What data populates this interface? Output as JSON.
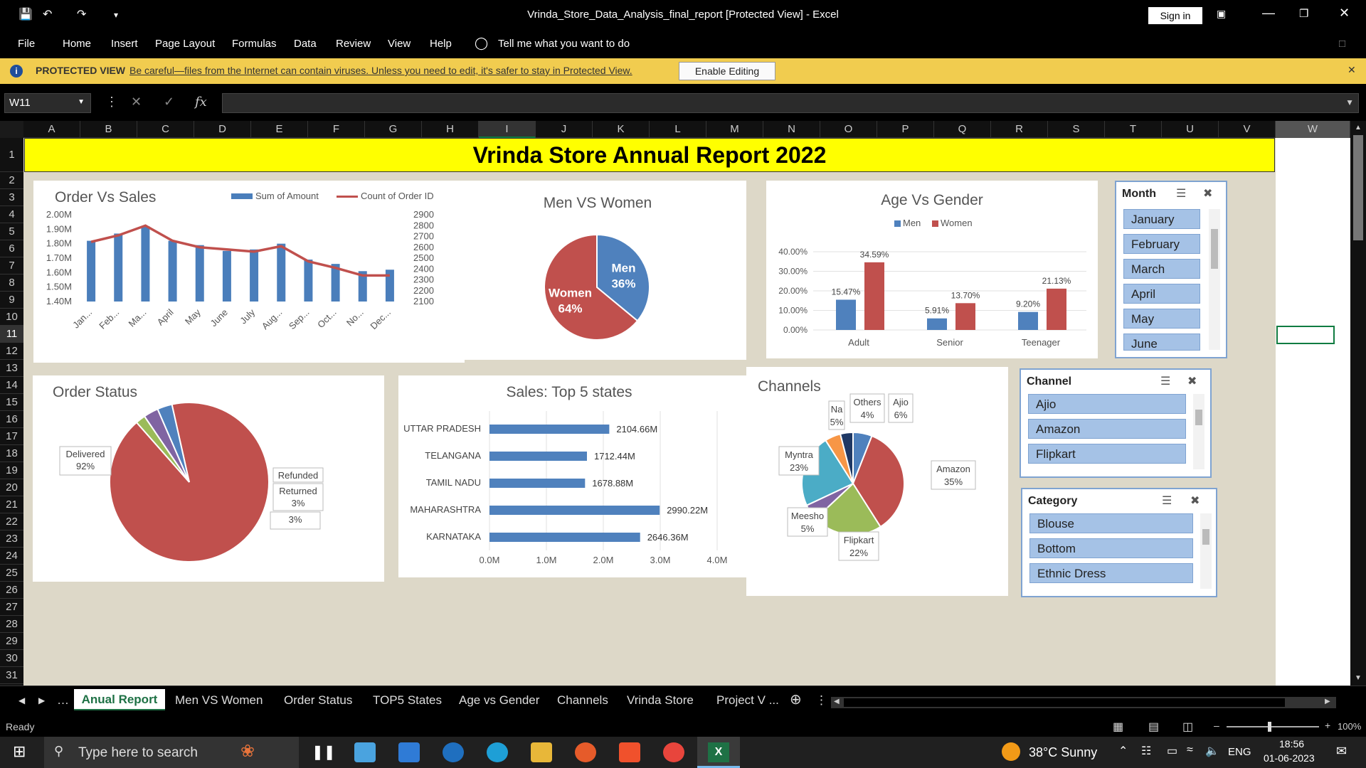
{
  "titlebar": {
    "title": "Vrinda_Store_Data_Analysis_final_report  [Protected View]  -  Excel",
    "signin": "Sign in"
  },
  "ribbon": {
    "tabs": [
      "File",
      "Home",
      "Insert",
      "Page Layout",
      "Formulas",
      "Data",
      "Review",
      "View",
      "Help"
    ],
    "tell_me": "Tell me what you want to do"
  },
  "protected": {
    "label": "PROTECTED VIEW",
    "message": "Be careful—files from the Internet can contain viruses. Unless you need to edit, it's safer to stay in Protected View.",
    "button": "Enable Editing"
  },
  "formula": {
    "name_box": "W11",
    "fx": "fx",
    "value": ""
  },
  "columns": [
    "A",
    "B",
    "C",
    "D",
    "E",
    "F",
    "G",
    "H",
    "I",
    "J",
    "K",
    "L",
    "M",
    "N",
    "O",
    "P",
    "Q",
    "R",
    "S",
    "T",
    "U",
    "V",
    "W"
  ],
  "rows": [
    "1",
    "2",
    "3",
    "4",
    "5",
    "6",
    "7",
    "8",
    "9",
    "10",
    "11",
    "12",
    "13",
    "14",
    "15",
    "16",
    "17",
    "18",
    "19",
    "20",
    "21",
    "22",
    "23",
    "24",
    "25",
    "26",
    "27",
    "28",
    "29",
    "30",
    "31"
  ],
  "report_title": "Vrinda Store Annual Report 2022",
  "charts": {
    "order_vs_sales": {
      "title": "Order Vs Sales",
      "legend": [
        "Sum of Amount",
        "Count of Order ID"
      ],
      "colors": [
        "#4a7ebb",
        "#c0504d"
      ]
    },
    "men_vs_women": {
      "title": "Men VS Women"
    },
    "age_vs_gender": {
      "title": "Age Vs Gender",
      "legend": [
        "Men",
        "Women"
      ]
    },
    "order_status": {
      "title": "Order Status"
    },
    "top5_states": {
      "title": "Sales: Top 5 states"
    },
    "channels": {
      "title": "Channels"
    }
  },
  "chart_data": [
    {
      "type": "bar+line",
      "title": "Order Vs Sales",
      "categories": [
        "Jan...",
        "Feb...",
        "Ma...",
        "April",
        "May",
        "June",
        "July",
        "Aug...",
        "Sep...",
        "Oct...",
        "No...",
        "Dec..."
      ],
      "series": [
        {
          "name": "Sum of Amount",
          "type": "bar",
          "axis": "left",
          "values": [
            1.82,
            1.87,
            1.92,
            1.82,
            1.79,
            1.75,
            1.76,
            1.8,
            1.69,
            1.66,
            1.61,
            1.62
          ]
        },
        {
          "name": "Count of Order ID",
          "type": "line",
          "axis": "right",
          "values": [
            2650,
            2710,
            2800,
            2660,
            2600,
            2580,
            2560,
            2610,
            2470,
            2410,
            2340,
            2340
          ]
        }
      ],
      "yticks_left": [
        "2.00M",
        "1.90M",
        "1.80M",
        "1.70M",
        "1.60M",
        "1.50M",
        "1.40M"
      ],
      "ylim_left": [
        1.4,
        2.0
      ],
      "yticks_right": [
        "2900",
        "2800",
        "2700",
        "2600",
        "2500",
        "2400",
        "2300",
        "2200",
        "2100"
      ],
      "ylim_right": [
        2100,
        2900
      ]
    },
    {
      "type": "pie",
      "title": "Men VS Women",
      "labels": [
        "Men",
        "Women"
      ],
      "values": [
        36,
        64
      ],
      "data_labels": [
        "36%",
        "64%"
      ],
      "colors": [
        "#4f81bd",
        "#c0504d"
      ]
    },
    {
      "type": "bar",
      "title": "Age Vs Gender",
      "categories": [
        "Adult",
        "Senior",
        "Teenager"
      ],
      "series": [
        {
          "name": "Men",
          "values": [
            15.47,
            5.91,
            9.2
          ],
          "labels": [
            "15.47%",
            "5.91%",
            "9.20%"
          ]
        },
        {
          "name": "Women",
          "values": [
            34.59,
            13.7,
            21.13
          ],
          "labels": [
            "34.59%",
            "13.70%",
            "21.13%"
          ]
        }
      ],
      "yticks": [
        "40.00%",
        "30.00%",
        "20.00%",
        "10.00%",
        "0.00%"
      ],
      "ylim": [
        0,
        40
      ]
    },
    {
      "type": "pie",
      "title": "Order Status",
      "labels": [
        "Delivered",
        "Refunded",
        "Returned",
        ""
      ],
      "values": [
        92,
        2,
        3,
        3
      ],
      "data_labels": [
        "Delivered\n92%",
        "Refunded",
        "Returned\n3%",
        "3%"
      ],
      "colors": [
        "#c0504d",
        "#9bbb59",
        "#8064a2",
        "#4f81bd"
      ]
    },
    {
      "type": "bar",
      "orientation": "horizontal",
      "title": "Sales: Top 5 states",
      "categories": [
        "UTTAR PRADESH",
        "TELANGANA",
        "TAMIL NADU",
        "MAHARASHTRA",
        "KARNATAKA"
      ],
      "values": [
        2.10466,
        1.71244,
        1.67888,
        2.99022,
        2.64636
      ],
      "data_labels": [
        "2104.66M",
        "1712.44M",
        "1678.88M",
        "2990.22M",
        "2646.36M"
      ],
      "xticks": [
        "0.0M",
        "1.0M",
        "2.0M",
        "3.0M",
        "4.0M"
      ],
      "xlim": [
        0,
        4
      ]
    },
    {
      "type": "pie",
      "title": "Channels",
      "labels": [
        "Ajio",
        "Amazon",
        "Flipkart",
        "Meesho",
        "Myntra",
        "Na...",
        "Others"
      ],
      "values": [
        6,
        35,
        22,
        5,
        23,
        5,
        4
      ],
      "data_labels": [
        "Ajio\n6%",
        "Amazon\n35%",
        "Flipkart\n22%",
        "Meesho\n5%",
        "Myntra\n23%",
        "Na\n5%",
        "Others\n4%"
      ],
      "colors": [
        "#4f81bd",
        "#c0504d",
        "#9bbb59",
        "#8064a2",
        "#4bacc6",
        "#f79646",
        "#1f3864"
      ]
    }
  ],
  "slicers": {
    "month": {
      "title": "Month",
      "items": [
        "January",
        "February",
        "March",
        "April",
        "May",
        "June"
      ]
    },
    "channel": {
      "title": "Channel",
      "items": [
        "Ajio",
        "Amazon",
        "Flipkart"
      ]
    },
    "category": {
      "title": "Category",
      "items": [
        "Blouse",
        "Bottom",
        "Ethnic Dress"
      ]
    }
  },
  "sheet_tabs": [
    "Anual Report",
    "Men VS Women",
    "Order Status",
    "TOP5 States",
    "Age vs Gender",
    "Channels",
    "Vrinda Store",
    "Project V ..."
  ],
  "status": {
    "ready": "Ready",
    "zoom": "100%"
  },
  "taskbar": {
    "search_placeholder": "Type here to search",
    "weather": "38°C  Sunny",
    "lang": "ENG",
    "time": "18:56",
    "date": "01-06-2023"
  }
}
